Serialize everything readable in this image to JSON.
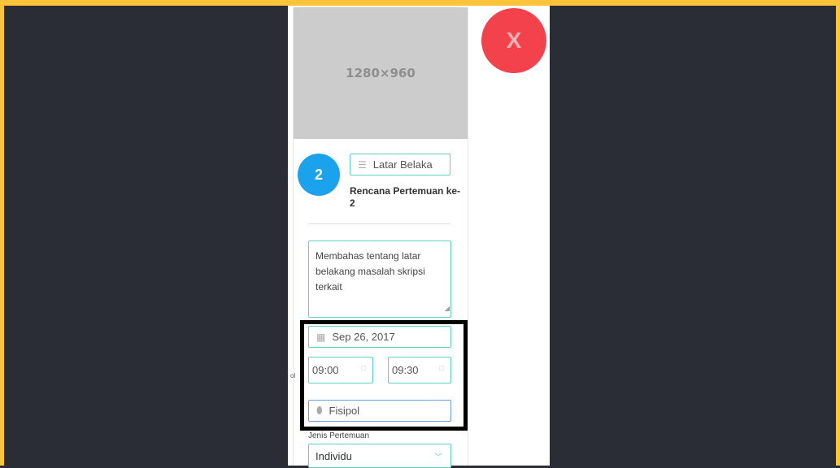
{
  "colors": {
    "frame": "#fcc33b",
    "background": "#2b2d36",
    "accent": "#5ed2c2",
    "step": "#1aa3ec",
    "close": "#f4424c"
  },
  "image_placeholder": "1280×960",
  "close_button": {
    "label": "X"
  },
  "step": {
    "number": "2"
  },
  "topic": {
    "value": "Latar Belaka",
    "icon": "menu-icon"
  },
  "meeting_title": "Rencana Pertemuan ke-2",
  "description": "Membahas tentang latar belakang masalah skripsi terkait",
  "date": {
    "value": "Sep 26, 2017",
    "icon": "calendar-icon"
  },
  "time_start": "09:00",
  "time_end": "09:30",
  "location": {
    "value": "Fisipol",
    "icon": "map-pin-icon"
  },
  "stray_text": "ol",
  "meeting_type": {
    "label": "Jenis Pertemuan",
    "value": "Individu"
  }
}
